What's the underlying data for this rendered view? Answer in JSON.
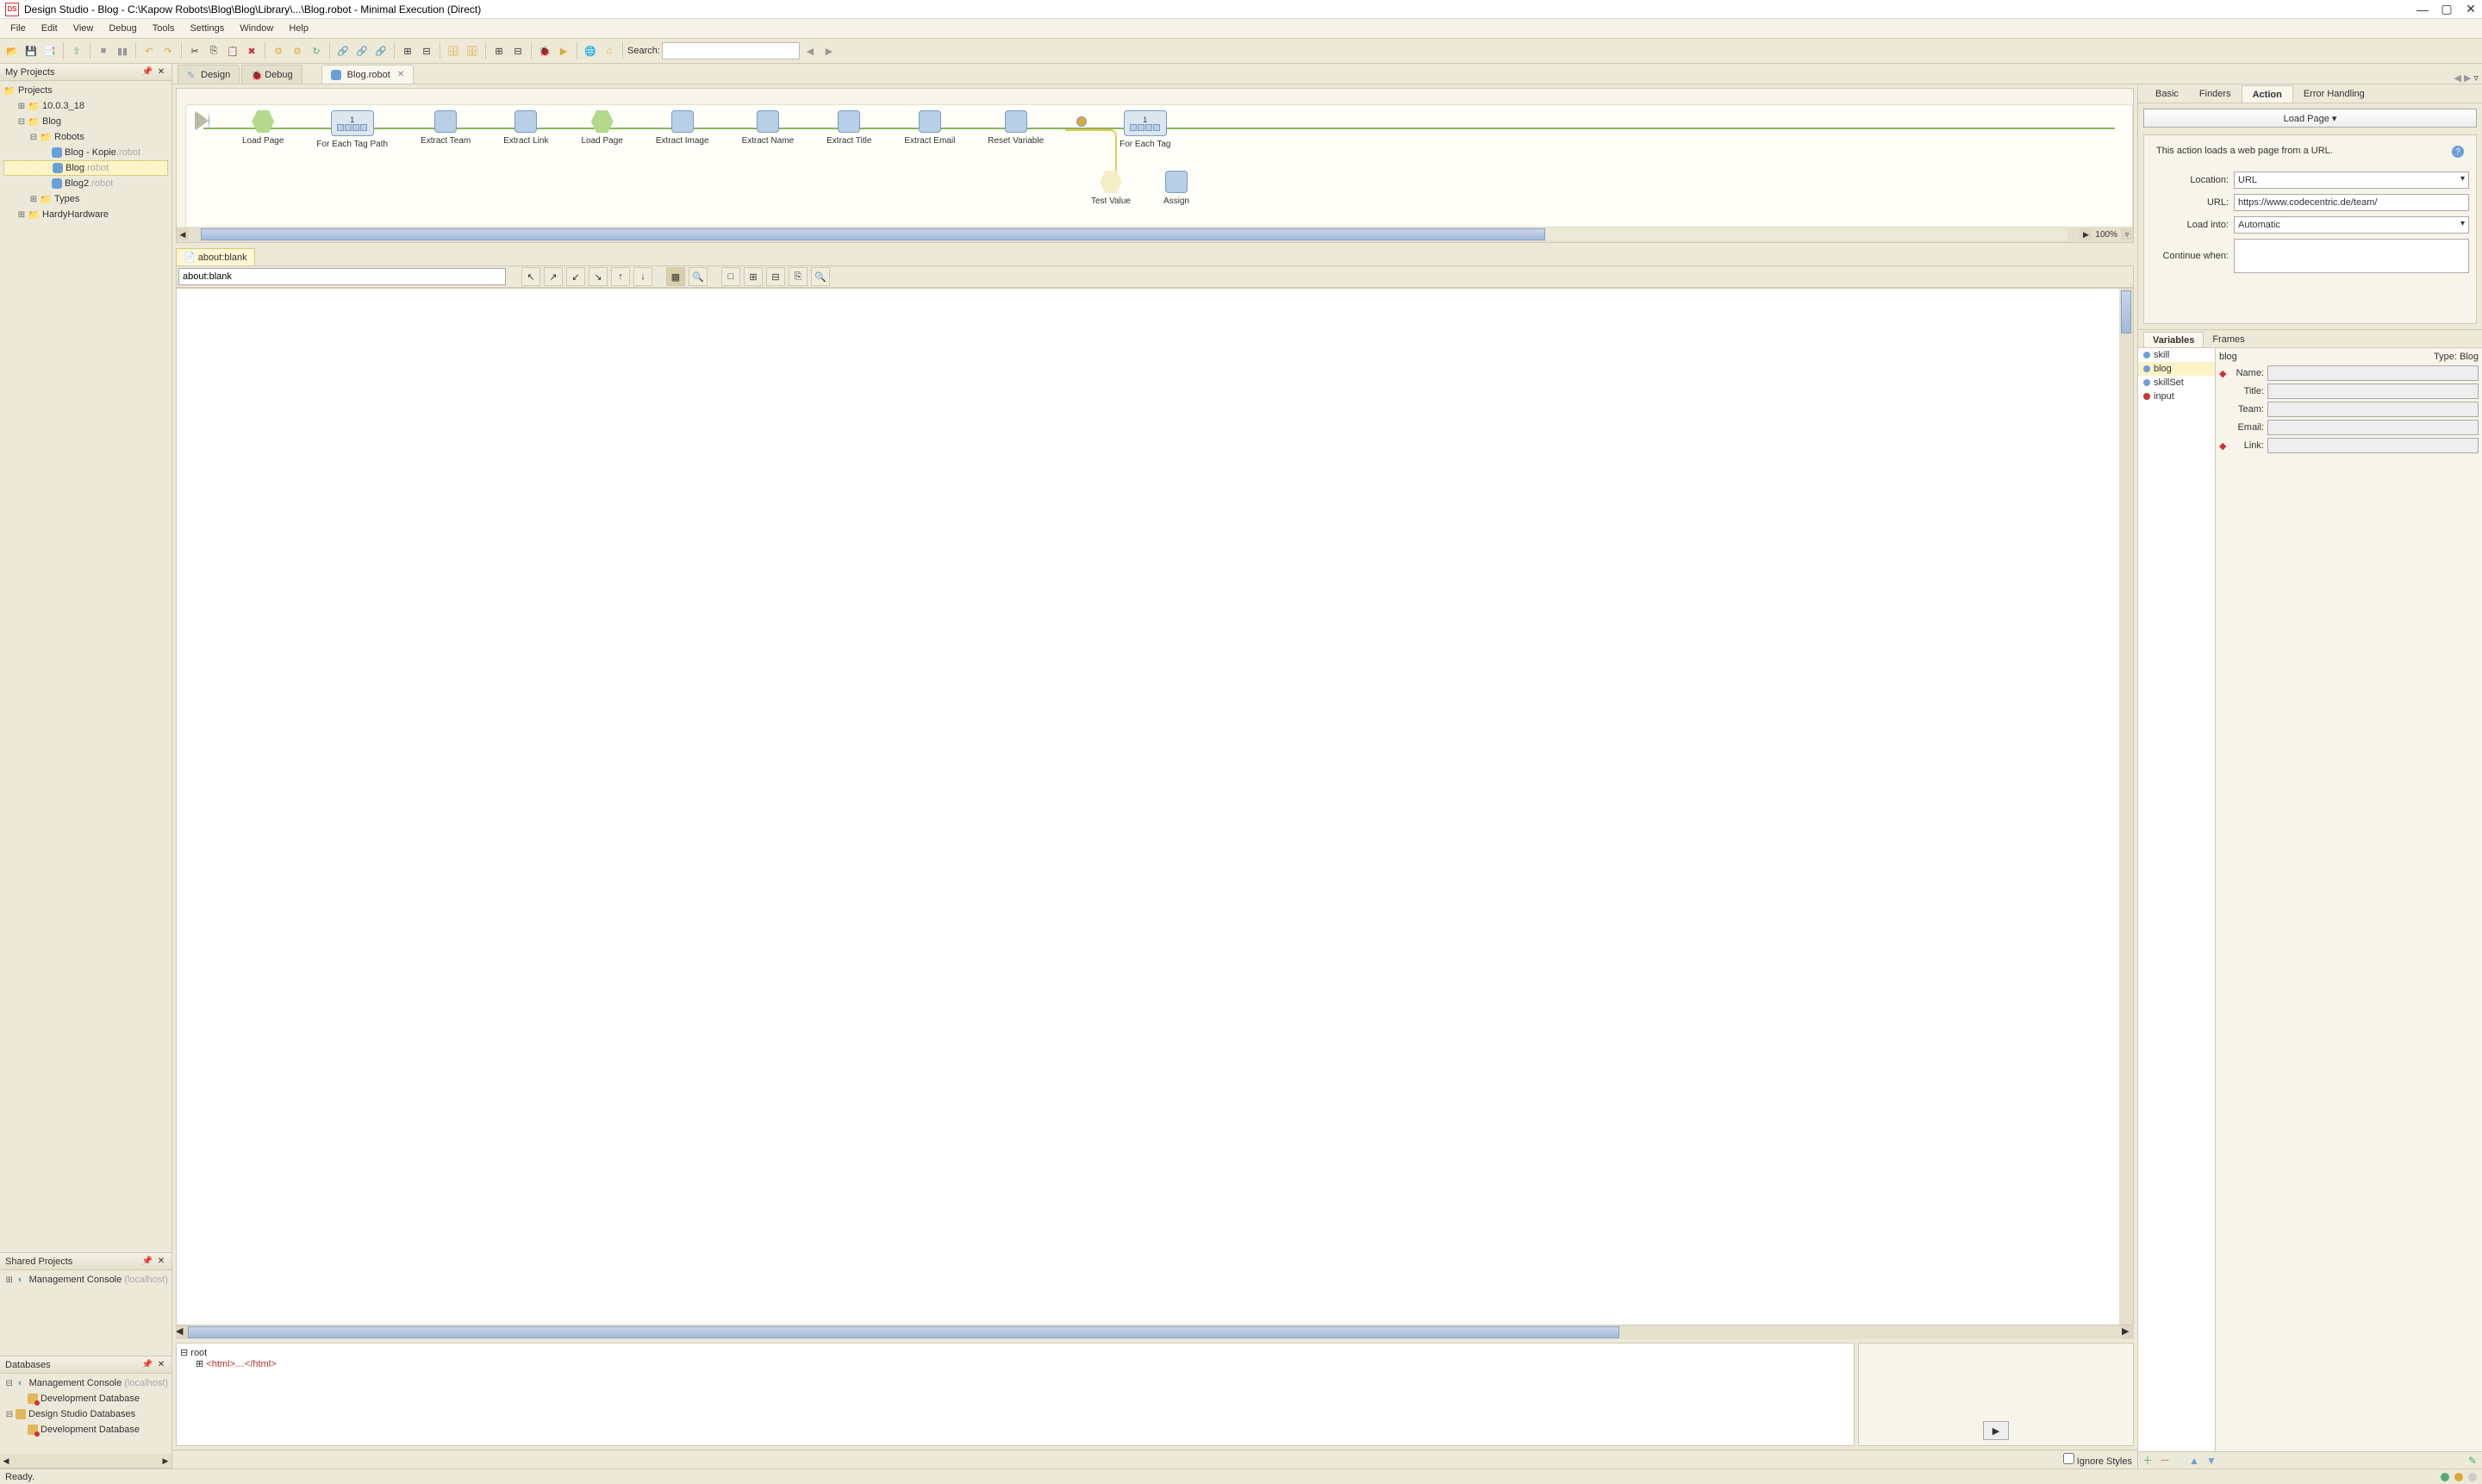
{
  "window": {
    "app_icon": "DS",
    "title": "Design Studio - Blog - C:\\Kapow Robots\\Blog\\Blog\\Library\\...\\Blog.robot - Minimal Execution (Direct)"
  },
  "menubar": [
    "File",
    "Edit",
    "View",
    "Debug",
    "Tools",
    "Settings",
    "Window",
    "Help"
  ],
  "toolbar": {
    "search_label": "Search:",
    "search_value": ""
  },
  "tabs": {
    "design": "Design",
    "debug": "Debug",
    "blog_robot": "Blog.robot",
    "nav_arrows": [
      "◀",
      "▶",
      "▿"
    ]
  },
  "left": {
    "my_projects": "My Projects",
    "projects_root": "Projects",
    "tree": {
      "p1": "10.0.3_18",
      "blog": "Blog",
      "robots": "Robots",
      "blog_kopie": "Blog - Kopie",
      "robot_ext": ".robot",
      "blog_item": "Blog",
      "blog2": "Blog2",
      "types": "Types",
      "hardy": "HardyHardware"
    },
    "shared_projects": "Shared Projects",
    "mgmt_console": "Management Console",
    "localhost": "(localhost)",
    "databases": "Databases",
    "dev_db": "Development Database",
    "ds_dbs": "Design Studio Databases"
  },
  "flow": {
    "nodes": [
      "Load Page",
      "For Each Tag Path",
      "Extract Team",
      "Extract Link",
      "Load Page",
      "Extract Image",
      "Extract Name",
      "Extract Title",
      "Extract Email",
      "Reset Variable",
      "",
      "For Each Tag"
    ],
    "row2": [
      "Test Value",
      "Assign"
    ],
    "for_each_num": "1",
    "zoom": "100%"
  },
  "browser": {
    "tab_label": "about:blank",
    "url": "about:blank"
  },
  "dom": {
    "root": "root",
    "html": "<html>…</html>",
    "ignore_styles": "Ignore Styles"
  },
  "right": {
    "tabs": [
      "Basic",
      "Finders",
      "Action",
      "Error Handling"
    ],
    "action_dropdown": "Load Page ▾",
    "description": "This action loads a web page from a URL.",
    "location_label": "Location:",
    "location_value": "URL",
    "url_label": "URL:",
    "url_value": "https://www.codecentric.de/team/",
    "loadinto_label": "Load into:",
    "loadinto_value": "Automatic",
    "continue_label": "Continue when:"
  },
  "vars": {
    "tabs": [
      "Variables",
      "Frames"
    ],
    "list": [
      "skill",
      "blog",
      "skillSet",
      "input"
    ],
    "selected": "blog",
    "type_prefix": "Type: ",
    "type": "Blog",
    "fields": {
      "name": "Name:",
      "title": "Title:",
      "team": "Team:",
      "email": "Email:",
      "link": "Link:"
    }
  },
  "statusbar": {
    "ready": "Ready."
  }
}
